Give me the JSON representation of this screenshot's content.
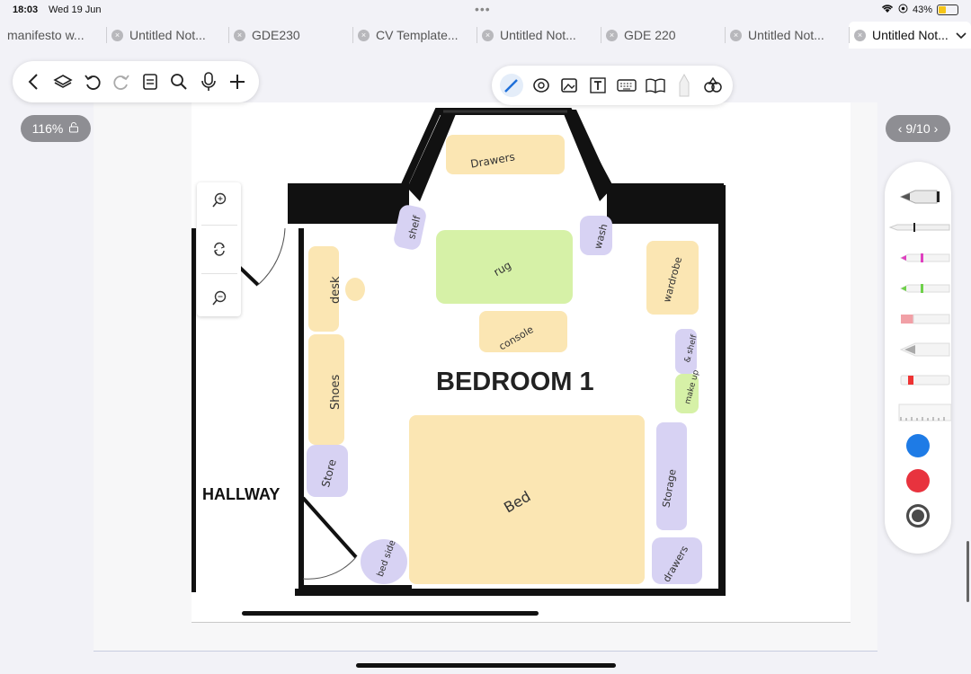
{
  "status": {
    "time": "18:03",
    "date": "Wed 19 Jun",
    "battery": "43%",
    "battery_level": 0.43
  },
  "tabs": [
    {
      "label": "manifesto w...",
      "closable": false
    },
    {
      "label": "Untitled Not...",
      "closable": true
    },
    {
      "label": "GDE230",
      "closable": true
    },
    {
      "label": "CV Template...",
      "closable": true
    },
    {
      "label": "Untitled Not...",
      "closable": true
    },
    {
      "label": "GDE 220",
      "closable": true
    },
    {
      "label": "Untitled Not...",
      "closable": true
    },
    {
      "label": "Untitled Not...",
      "closable": true,
      "active": true
    }
  ],
  "nav_toolbar": {
    "icons": [
      "back-icon",
      "layers-icon",
      "undo-icon",
      "redo-icon",
      "document-icon",
      "search-icon",
      "microphone-icon",
      "add-icon"
    ]
  },
  "tool_toolbar": {
    "icons": [
      "pen-icon",
      "lasso-icon",
      "image-icon",
      "text-box-icon",
      "keyboard-icon",
      "book-icon",
      "laser-icon",
      "shapes-icon"
    ]
  },
  "zoom": "116%",
  "page_indicator": "9/10",
  "floorplan": {
    "title": "BEDROOM 1",
    "hallway": "HALLWAY",
    "labels": {
      "drawers_top": "Drawers",
      "shelf_top": "shelf",
      "rug": "rug",
      "wash": "wash",
      "desk": "desk",
      "console": "console",
      "wardrobe": "wardrobe",
      "shelf_right": "& shelf",
      "make_up": "make up",
      "shoes": "Shoes",
      "store": "Store",
      "bed": "Bed",
      "storage": "Storage",
      "bed_side": "bed side",
      "drawers_bottom": "drawers"
    }
  },
  "palette": {
    "colors": [
      "#1e7be6",
      "#e8333e",
      "#4a4a4a"
    ]
  }
}
